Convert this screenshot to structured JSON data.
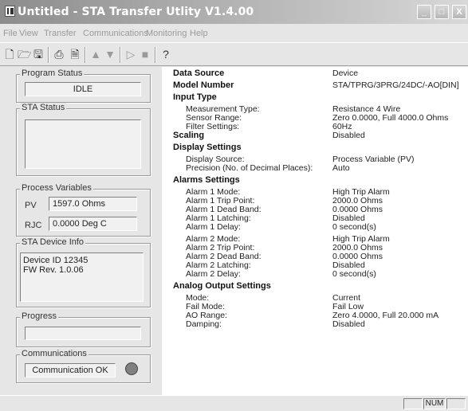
{
  "window": {
    "title": "Untitled - STA Transfer Utlity V1.4.00",
    "controls": {
      "minimize": "_",
      "maximize": "□",
      "close": "X"
    }
  },
  "menu": [
    "File",
    "View",
    "Transfer",
    "Communications",
    "Monitoring",
    "Help"
  ],
  "toolbar": [
    "new-icon",
    "open-icon",
    "save-icon",
    "print-icon",
    "print-preview-icon",
    "upload-icon",
    "download-icon",
    "play-icon",
    "stop-icon",
    "help-icon"
  ],
  "left": {
    "program_status": {
      "title": "Program Status",
      "value": "IDLE"
    },
    "sta_status": {
      "title": "STA Status",
      "value": ""
    },
    "process_variables": {
      "title": "Process Variables",
      "pv_label": "PV",
      "pv_value": "1597.0 Ohms",
      "rjc_label": "RJC",
      "rjc_value": "0.0000 Deg C"
    },
    "device_info": {
      "title": "STA Device Info",
      "line1": "Device ID 12345",
      "line2": "FW Rev. 1.0.06"
    },
    "progress": {
      "title": "Progress",
      "value": 0
    },
    "communications": {
      "title": "Communications",
      "value": "Communication OK",
      "led_color": "#808080"
    }
  },
  "content": {
    "rows": [
      {
        "label": "Data Source",
        "value": "Device",
        "kind": "head"
      },
      {
        "label": "Model Number",
        "value": "STA/TPRG/3PRG/24DC/-AO[DIN]",
        "kind": "head"
      },
      {
        "label": "Input Type",
        "value": "",
        "kind": "head"
      },
      {
        "label": "Measurement Type:",
        "value": "Resistance 4 Wire",
        "kind": "sub"
      },
      {
        "label": "Sensor Range:",
        "value": "Zero 0.0000, Full 4000.0 Ohms",
        "kind": "sub"
      },
      {
        "label": "Filter Settings:",
        "value": "60Hz",
        "kind": "sub"
      },
      {
        "label": "Scaling",
        "value": "Disabled",
        "kind": "head"
      },
      {
        "label": "Display Settings",
        "value": "",
        "kind": "head"
      },
      {
        "label": "Display Source:",
        "value": "Process Variable (PV)",
        "kind": "sub"
      },
      {
        "label": "Precision (No. of Decimal Places):",
        "value": "Auto",
        "kind": "sub"
      },
      {
        "label": "Alarms Settings",
        "value": "",
        "kind": "head"
      },
      {
        "label": "Alarm 1 Mode:",
        "value": "High Trip Alarm",
        "kind": "sub"
      },
      {
        "label": "Alarm 1 Trip Point:",
        "value": "2000.0 Ohms",
        "kind": "sub"
      },
      {
        "label": "Alarm 1 Dead Band:",
        "value": "0.0000 Ohms",
        "kind": "sub"
      },
      {
        "label": "Alarm 1 Latching:",
        "value": "Disabled",
        "kind": "sub"
      },
      {
        "label": "Alarm 1 Delay:",
        "value": "0 second(s)",
        "kind": "sub"
      },
      {
        "label": "Alarm 2 Mode:",
        "value": "High Trip Alarm",
        "kind": "sub"
      },
      {
        "label": "Alarm 2 Trip Point:",
        "value": "2000.0 Ohms",
        "kind": "sub"
      },
      {
        "label": "Alarm 2 Dead Band:",
        "value": "0.0000 Ohms",
        "kind": "sub"
      },
      {
        "label": "Alarm 2 Latching:",
        "value": "Disabled",
        "kind": "sub"
      },
      {
        "label": "Alarm 2 Delay:",
        "value": "0 second(s)",
        "kind": "sub"
      },
      {
        "label": "Analog Output Settings",
        "value": "",
        "kind": "head"
      },
      {
        "label": "Mode:",
        "value": "Current",
        "kind": "sub"
      },
      {
        "label": "Fail Mode:",
        "value": "Fail Low",
        "kind": "sub"
      },
      {
        "label": "AO Range:",
        "value": "Zero 4.0000, Full 20.000 mA",
        "kind": "sub"
      },
      {
        "label": "Damping:",
        "value": "Disabled",
        "kind": "sub"
      }
    ]
  },
  "statusbar": {
    "num": "NUM"
  }
}
